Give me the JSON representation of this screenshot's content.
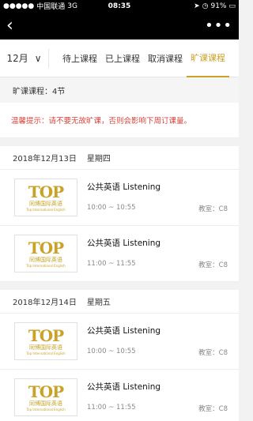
{
  "status": {
    "carrier": "中国联通",
    "network": "3G",
    "time": "08:35",
    "battery": "91%"
  },
  "tabs": {
    "month": "12月",
    "items": [
      "待上课程",
      "已上课程",
      "取消课程",
      "旷课课程"
    ],
    "active_index": 3
  },
  "summary": {
    "text": "旷课课程：4节"
  },
  "tip": {
    "text": "温馨提示：请不要无故旷课，否则会影响下周订课量。"
  },
  "logo": {
    "main": "TOP",
    "sub": "同博国际英语",
    "tiny": "Top International English"
  },
  "groups": [
    {
      "date": "2018年12月13日",
      "weekday": "星期四",
      "items": [
        {
          "course": "公共英语 Listening",
          "time": "10:00 ~ 10:55",
          "room": "教室：C8"
        },
        {
          "course": "公共英语 Listening",
          "time": "11:00 ~ 11:55",
          "room": "教室：C8"
        }
      ]
    },
    {
      "date": "2018年12月14日",
      "weekday": "星期五",
      "items": [
        {
          "course": "公共英语 Listening",
          "time": "10:00 ~ 10:55",
          "room": "教室：C8"
        },
        {
          "course": "公共英语 Listening",
          "time": "11:00 ~ 11:55",
          "room": "教室：C8"
        }
      ]
    }
  ],
  "colors": {
    "accent": "#c9a227",
    "warning": "#d64541"
  }
}
